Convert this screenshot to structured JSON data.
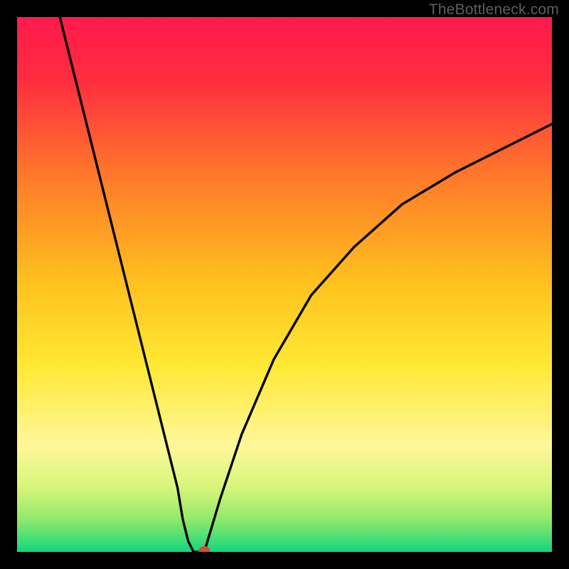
{
  "watermark": "TheBottleneck.com",
  "chart_data": {
    "type": "line",
    "title": "",
    "xlabel": "",
    "ylabel": "",
    "xlim": [
      0,
      100
    ],
    "ylim": [
      0,
      100
    ],
    "background": "rainbow-gradient",
    "gradient_stops": [
      {
        "offset": 0,
        "color": "#ff1a4b"
      },
      {
        "offset": 12,
        "color": "#ff2d3f"
      },
      {
        "offset": 30,
        "color": "#ff7a2a"
      },
      {
        "offset": 50,
        "color": "#ffc21f"
      },
      {
        "offset": 65,
        "color": "#ffe833"
      },
      {
        "offset": 80,
        "color": "#fff79a"
      },
      {
        "offset": 88,
        "color": "#d6f57a"
      },
      {
        "offset": 94,
        "color": "#8fe96a"
      },
      {
        "offset": 100,
        "color": "#12d67e"
      }
    ],
    "series": [
      {
        "name": "left-branch",
        "x": [
          8,
          10,
          12,
          15,
          18,
          22,
          26,
          30,
          31,
          32,
          33
        ],
        "y": [
          100,
          92,
          84,
          72,
          60,
          44,
          28,
          12,
          6,
          2,
          0
        ]
      },
      {
        "name": "valley-floor",
        "x": [
          33,
          35
        ],
        "y": [
          0,
          0
        ]
      },
      {
        "name": "right-branch",
        "x": [
          35,
          38,
          42,
          48,
          55,
          63,
          72,
          82,
          92,
          100
        ],
        "y": [
          0,
          10,
          22,
          36,
          48,
          57,
          65,
          71,
          76,
          80
        ]
      }
    ],
    "marker": {
      "name": "optimum-point",
      "x": 35,
      "y": 0,
      "color": "#d24a3a"
    }
  }
}
